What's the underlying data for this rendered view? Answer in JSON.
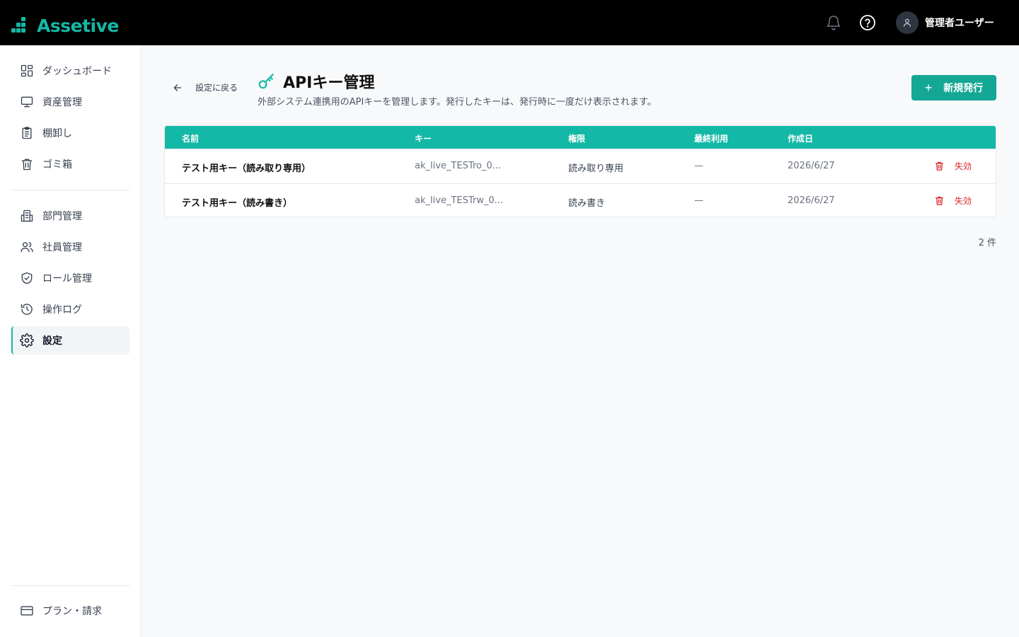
{
  "app": {
    "name": "Assetive",
    "brand_color": "#14b8a6"
  },
  "header": {
    "user_name": "管理者ユーザー",
    "icons": [
      "bell-icon",
      "help-icon",
      "user-icon"
    ]
  },
  "sidebar": {
    "items": [
      {
        "label": "ダッシュボード",
        "icon": "dashboard-icon"
      },
      {
        "label": "資産管理",
        "icon": "monitor-icon"
      },
      {
        "label": "棚卸し",
        "icon": "clipboard-icon"
      },
      {
        "label": "ゴミ箱",
        "icon": "trash-icon"
      },
      {
        "label": "部門管理",
        "icon": "building-icon"
      },
      {
        "label": "社員管理",
        "icon": "users-icon"
      },
      {
        "label": "ロール管理",
        "icon": "shield-icon"
      },
      {
        "label": "操作ログ",
        "icon": "history-icon"
      },
      {
        "label": "設定",
        "icon": "gear-icon",
        "active": true
      }
    ],
    "footer_item": {
      "label": "プラン・請求",
      "icon": "credit-card-icon"
    }
  },
  "page": {
    "back_label": "設定に戻る",
    "title": "APIキー管理",
    "description": "外部システム連携用のAPIキーを管理します。発行したキーは、発行時に一度だけ表示されます。",
    "new_button_label": "新規発行"
  },
  "table": {
    "columns": [
      "名前",
      "キー",
      "権限",
      "最終利用",
      "作成日"
    ],
    "rows": [
      {
        "name": "テスト用キー（読み取り専用）",
        "key": "ak_live_TESTro_0...",
        "permission": "読み取り専用",
        "last_used": "—",
        "created": "2026/6/27",
        "action": "失効"
      },
      {
        "name": "テスト用キー（読み書き）",
        "key": "ak_live_TESTrw_0...",
        "permission": "読み書き",
        "last_used": "—",
        "created": "2026/6/27",
        "action": "失効"
      }
    ],
    "count_label": "2 件"
  }
}
